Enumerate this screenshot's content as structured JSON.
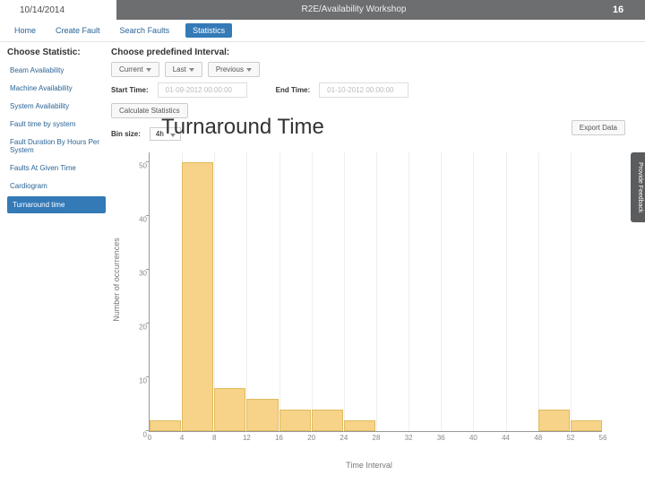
{
  "header": {
    "date": "10/14/2014",
    "center": "R2E/Availability Workshop",
    "page": "16"
  },
  "tabs": [
    "Home",
    "Create Fault",
    "Search Faults",
    "Statistics"
  ],
  "active_tab": 3,
  "sidebar": {
    "title": "Choose Statistic:",
    "items": [
      "Beam Availability",
      "Machine Availability",
      "System Availability",
      "Fault time by system",
      "Fault Duration By Hours Per System",
      "Faults At Given Time",
      "Cardiogram",
      "Turnaround time"
    ],
    "active": 7
  },
  "interval": {
    "title": "Choose predefined Interval:",
    "buttons": [
      "Current",
      "Last",
      "Previous"
    ],
    "start_label": "Start Time:",
    "start_value": "01-09-2012 00:00:00",
    "end_label": "End Time:",
    "end_value": "01-10-2012 00:00:00",
    "calc_label": "Calculate Statistics",
    "bin_label": "Bin size:",
    "bin_value": "4h",
    "export_label": "Export Data"
  },
  "overlay_title": "Turnaround Time",
  "feedback_label": "Provide Feedback",
  "chart_data": {
    "type": "bar",
    "title": "Turnaround Time",
    "xlabel": "Time Interval",
    "ylabel": "Number of occurrences",
    "x_ticks": [
      0,
      4,
      8,
      12,
      16,
      20,
      24,
      28,
      32,
      36,
      40,
      44,
      48,
      52,
      56
    ],
    "y_ticks": [
      0,
      10,
      20,
      30,
      40,
      50
    ],
    "ylim": [
      0,
      52
    ],
    "categories": [
      0,
      4,
      8,
      12,
      16,
      20,
      24,
      28,
      32,
      36,
      40,
      44,
      48,
      52
    ],
    "values": [
      2,
      50,
      8,
      6,
      4,
      4,
      2,
      0,
      0,
      0,
      0,
      0,
      4,
      2
    ]
  }
}
